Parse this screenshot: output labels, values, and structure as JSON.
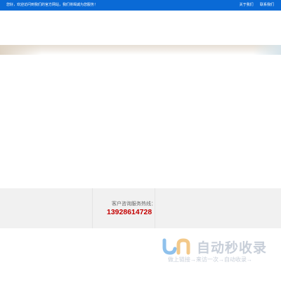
{
  "topbar": {
    "welcome": "您好，欢迎访问到我们的官方网站，我们将竭诚为您服务！",
    "links": [
      "关于我们",
      "联系我们"
    ],
    "bg_color": "#0a6ad6"
  },
  "footer": {
    "hotline_label": "客户咨询服务热线：",
    "hotline_number": "13928614728",
    "number_color": "#c40000"
  },
  "watermark": {
    "title": "自动秒收录",
    "subtitle": "做上链接→来访一次→自动收录→",
    "icon": "jr-logo-icon"
  }
}
